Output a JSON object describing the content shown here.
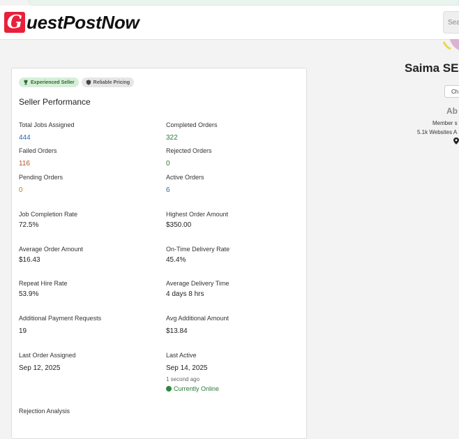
{
  "brand": {
    "logo_letter": "G",
    "logo_text": "uestPostNow"
  },
  "header": {
    "search_placeholder": "Sear"
  },
  "card": {
    "badges": [
      {
        "label": "Experienced Seller",
        "icon": "trophy-icon",
        "color": "#d7efd9"
      },
      {
        "label": "Reliable Pricing",
        "icon": "shield-icon",
        "color": "#e6e6e6"
      }
    ],
    "title": "Seller Performance",
    "stats": {
      "total_jobs": {
        "label": "Total Jobs Assigned",
        "value": "444"
      },
      "completed": {
        "label": "Completed Orders",
        "value": "322"
      },
      "failed": {
        "label": "Failed Orders",
        "value": "116"
      },
      "rejected": {
        "label": "Rejected Orders",
        "value": "0"
      },
      "pending": {
        "label": "Pending Orders",
        "value": "0"
      },
      "active": {
        "label": "Active Orders",
        "value": "6"
      },
      "completion_rate": {
        "label": "Job Completion Rate",
        "value": "72.5%"
      },
      "highest_order": {
        "label": "Highest Order Amount",
        "value": "$350.00"
      },
      "avg_order": {
        "label": "Average Order Amount",
        "value": "$16.43"
      },
      "on_time": {
        "label": "On-Time Delivery Rate",
        "value": "45.4%"
      },
      "repeat_hire": {
        "label": "Repeat Hire Rate",
        "value": "53.9%"
      },
      "avg_delivery": {
        "label": "Average Delivery Time",
        "value": "4 days 8 hrs"
      },
      "additional_requests": {
        "label": "Additional Payment Requests",
        "value": "19"
      },
      "avg_additional": {
        "label": "Avg Additional Amount",
        "value": "$13.84"
      },
      "last_order": {
        "label": "Last Order Assigned",
        "value": "Sep 12, 2025"
      },
      "last_active": {
        "label": "Last Active",
        "value": "Sep 14, 2025",
        "ago": "1 second ago",
        "status": "Currently Online"
      }
    },
    "rejection_title": "Rejection Analysis"
  },
  "profile": {
    "name": "Saima SE",
    "chat_label": "Ch",
    "about": "Ab",
    "member_since": "Member s",
    "websites": "5.1k Websites A"
  }
}
